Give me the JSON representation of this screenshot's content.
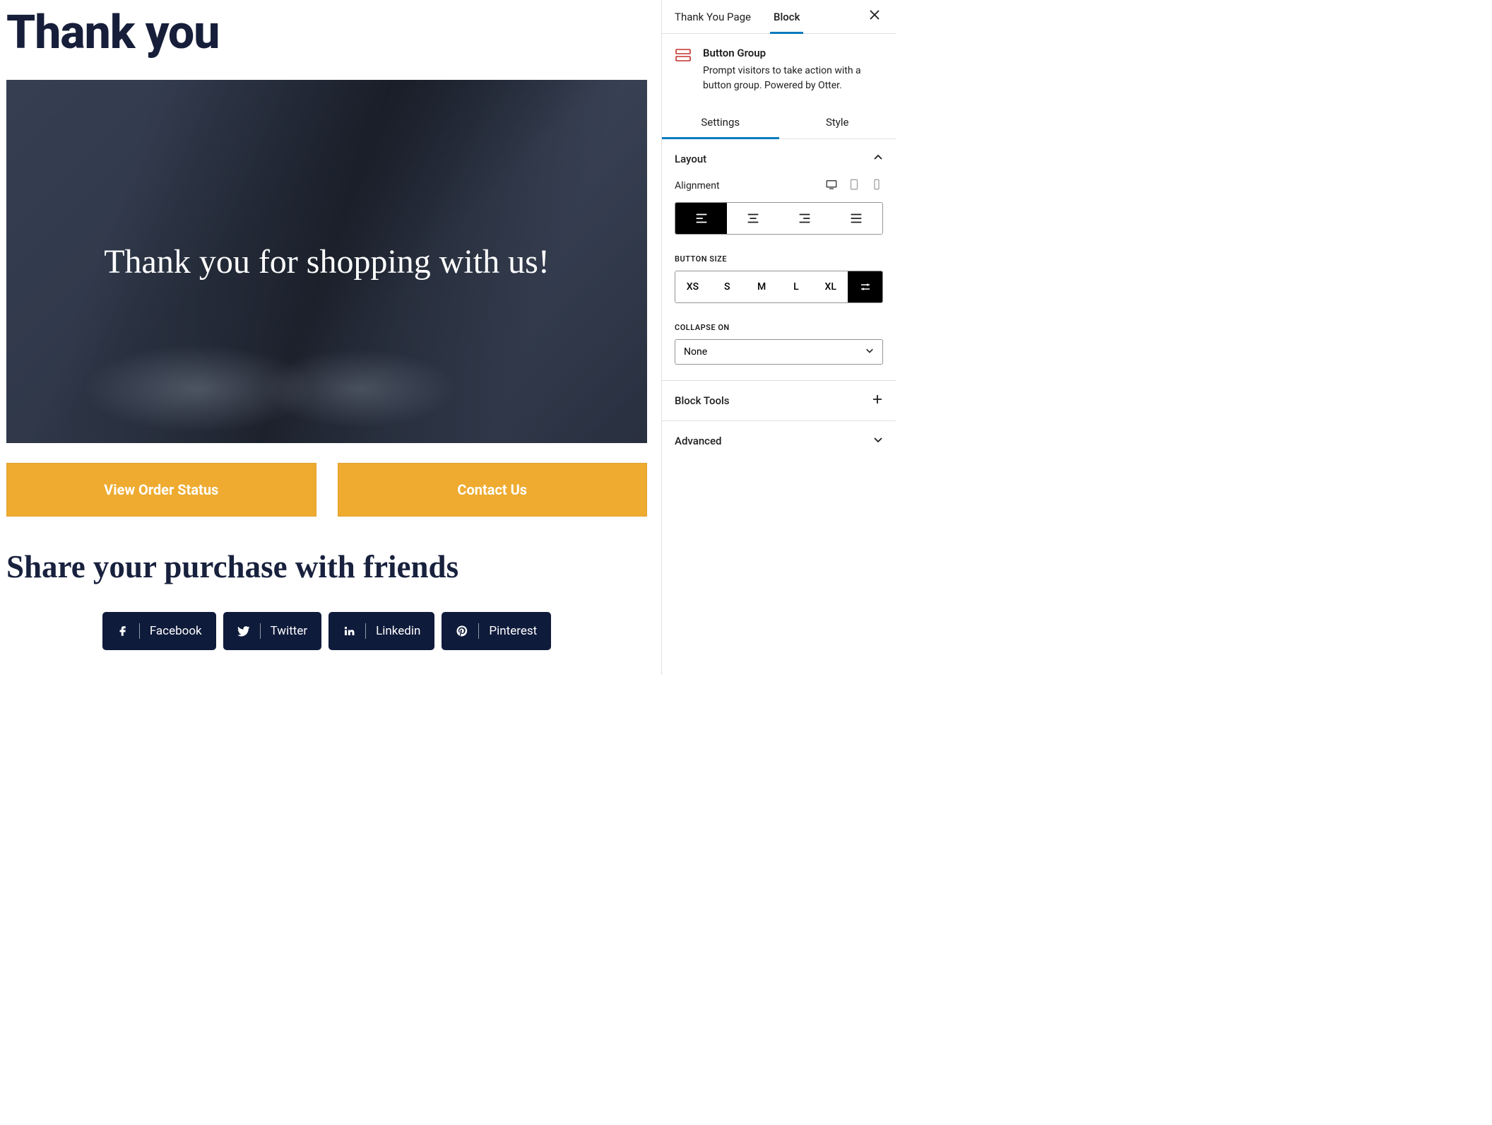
{
  "canvas": {
    "page_title": "Thank you",
    "hero_text": "Thank you for shopping with us!",
    "buttons": {
      "view_order": "View Order Status",
      "contact": "Contact Us"
    },
    "share_heading": "Share your purchase with friends",
    "social": {
      "facebook": "Facebook",
      "twitter": "Twitter",
      "linkedin": "Linkedin",
      "pinterest": "Pinterest"
    }
  },
  "sidebar": {
    "tabs": {
      "page": "Thank You Page",
      "block": "Block"
    },
    "block": {
      "name": "Button Group",
      "description": "Prompt visitors to take action with a button group. Powered by Otter."
    },
    "sub_tabs": {
      "settings": "Settings",
      "style": "Style"
    },
    "panels": {
      "layout": "Layout",
      "alignment_label": "Alignment",
      "button_size_label": "BUTTON SIZE",
      "sizes": {
        "xs": "XS",
        "s": "S",
        "m": "M",
        "l": "L",
        "xl": "XL"
      },
      "collapse_label": "COLLAPSE ON",
      "collapse_value": "None",
      "block_tools": "Block Tools",
      "advanced": "Advanced"
    }
  }
}
